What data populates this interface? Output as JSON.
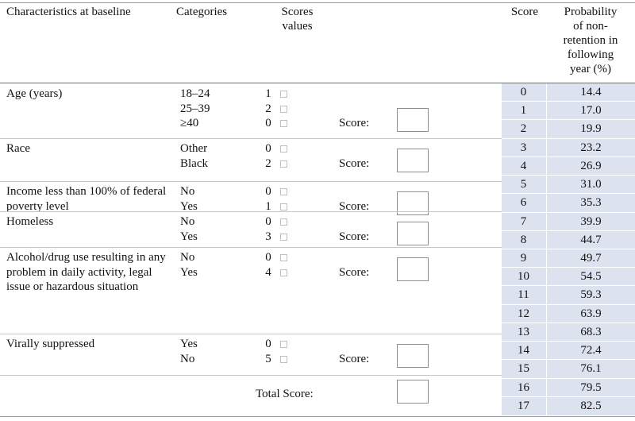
{
  "table": {
    "headers": {
      "characteristics": "Characteristics at baseline",
      "categories": "Categories",
      "scores_values": "Scores\nvalues",
      "score": "Score",
      "probability": "Probability\nof non-\nretention in\nfollowing\nyear (%)"
    },
    "score_label": "Score:",
    "total_label": "Total Score:",
    "sections": [
      {
        "characteristic": "Age (years)",
        "rows": [
          {
            "category": "18–24",
            "value": "1"
          },
          {
            "category": "25–39",
            "value": "2"
          },
          {
            "category": "≥40",
            "value": "0"
          }
        ]
      },
      {
        "characteristic": "Race",
        "rows": [
          {
            "category": "Other",
            "value": "0"
          },
          {
            "category": "Black",
            "value": "2"
          }
        ]
      },
      {
        "characteristic": "Income less than 100% of federal poverty level",
        "rows": [
          {
            "category": "No",
            "value": "0"
          },
          {
            "category": "Yes",
            "value": "1"
          }
        ]
      },
      {
        "characteristic": "Homeless",
        "rows": [
          {
            "category": "No",
            "value": "0"
          },
          {
            "category": "Yes",
            "value": "3"
          }
        ]
      },
      {
        "characteristic": "Alcohol/drug use resulting in any problem in daily activity, legal issue or hazardous situation",
        "rows": [
          {
            "category": "No",
            "value": "0"
          },
          {
            "category": "Yes",
            "value": "4"
          }
        ]
      },
      {
        "characteristic": "Virally suppressed",
        "rows": [
          {
            "category": "Yes",
            "value": "0"
          },
          {
            "category": "No",
            "value": "5"
          }
        ]
      }
    ]
  },
  "chart_data": {
    "type": "table",
    "title": "Probability of non-retention in following year (%) by total score",
    "columns": [
      "Score",
      "Probability of non-retention in following year (%)"
    ],
    "xlabel": "Score",
    "ylabel": "Probability of non-retention in following year (%)",
    "scores": [
      0,
      1,
      2,
      3,
      4,
      5,
      6,
      7,
      8,
      9,
      10,
      11,
      12,
      13,
      14,
      15,
      16,
      17
    ],
    "probabilities": [
      14.4,
      17.0,
      19.9,
      23.2,
      26.9,
      31.0,
      35.3,
      39.9,
      44.7,
      49.7,
      54.5,
      59.3,
      63.9,
      68.3,
      72.4,
      76.1,
      79.5,
      82.5
    ],
    "rows": [
      {
        "score": "0",
        "probability": "14.4"
      },
      {
        "score": "1",
        "probability": "17.0"
      },
      {
        "score": "2",
        "probability": "19.9"
      },
      {
        "score": "3",
        "probability": "23.2"
      },
      {
        "score": "4",
        "probability": "26.9"
      },
      {
        "score": "5",
        "probability": "31.0"
      },
      {
        "score": "6",
        "probability": "35.3"
      },
      {
        "score": "7",
        "probability": "39.9"
      },
      {
        "score": "8",
        "probability": "44.7"
      },
      {
        "score": "9",
        "probability": "49.7"
      },
      {
        "score": "10",
        "probability": "54.5"
      },
      {
        "score": "11",
        "probability": "59.3"
      },
      {
        "score": "12",
        "probability": "63.9"
      },
      {
        "score": "13",
        "probability": "68.3"
      },
      {
        "score": "14",
        "probability": "72.4"
      },
      {
        "score": "15",
        "probability": "76.1"
      },
      {
        "score": "16",
        "probability": "79.5"
      },
      {
        "score": "17",
        "probability": "82.5"
      }
    ]
  },
  "colors": {
    "shading": "#dde2ef",
    "rule": "#9a9a9a",
    "checkbox_border": "#bfbfbf",
    "input_border": "#8f8f8f"
  }
}
